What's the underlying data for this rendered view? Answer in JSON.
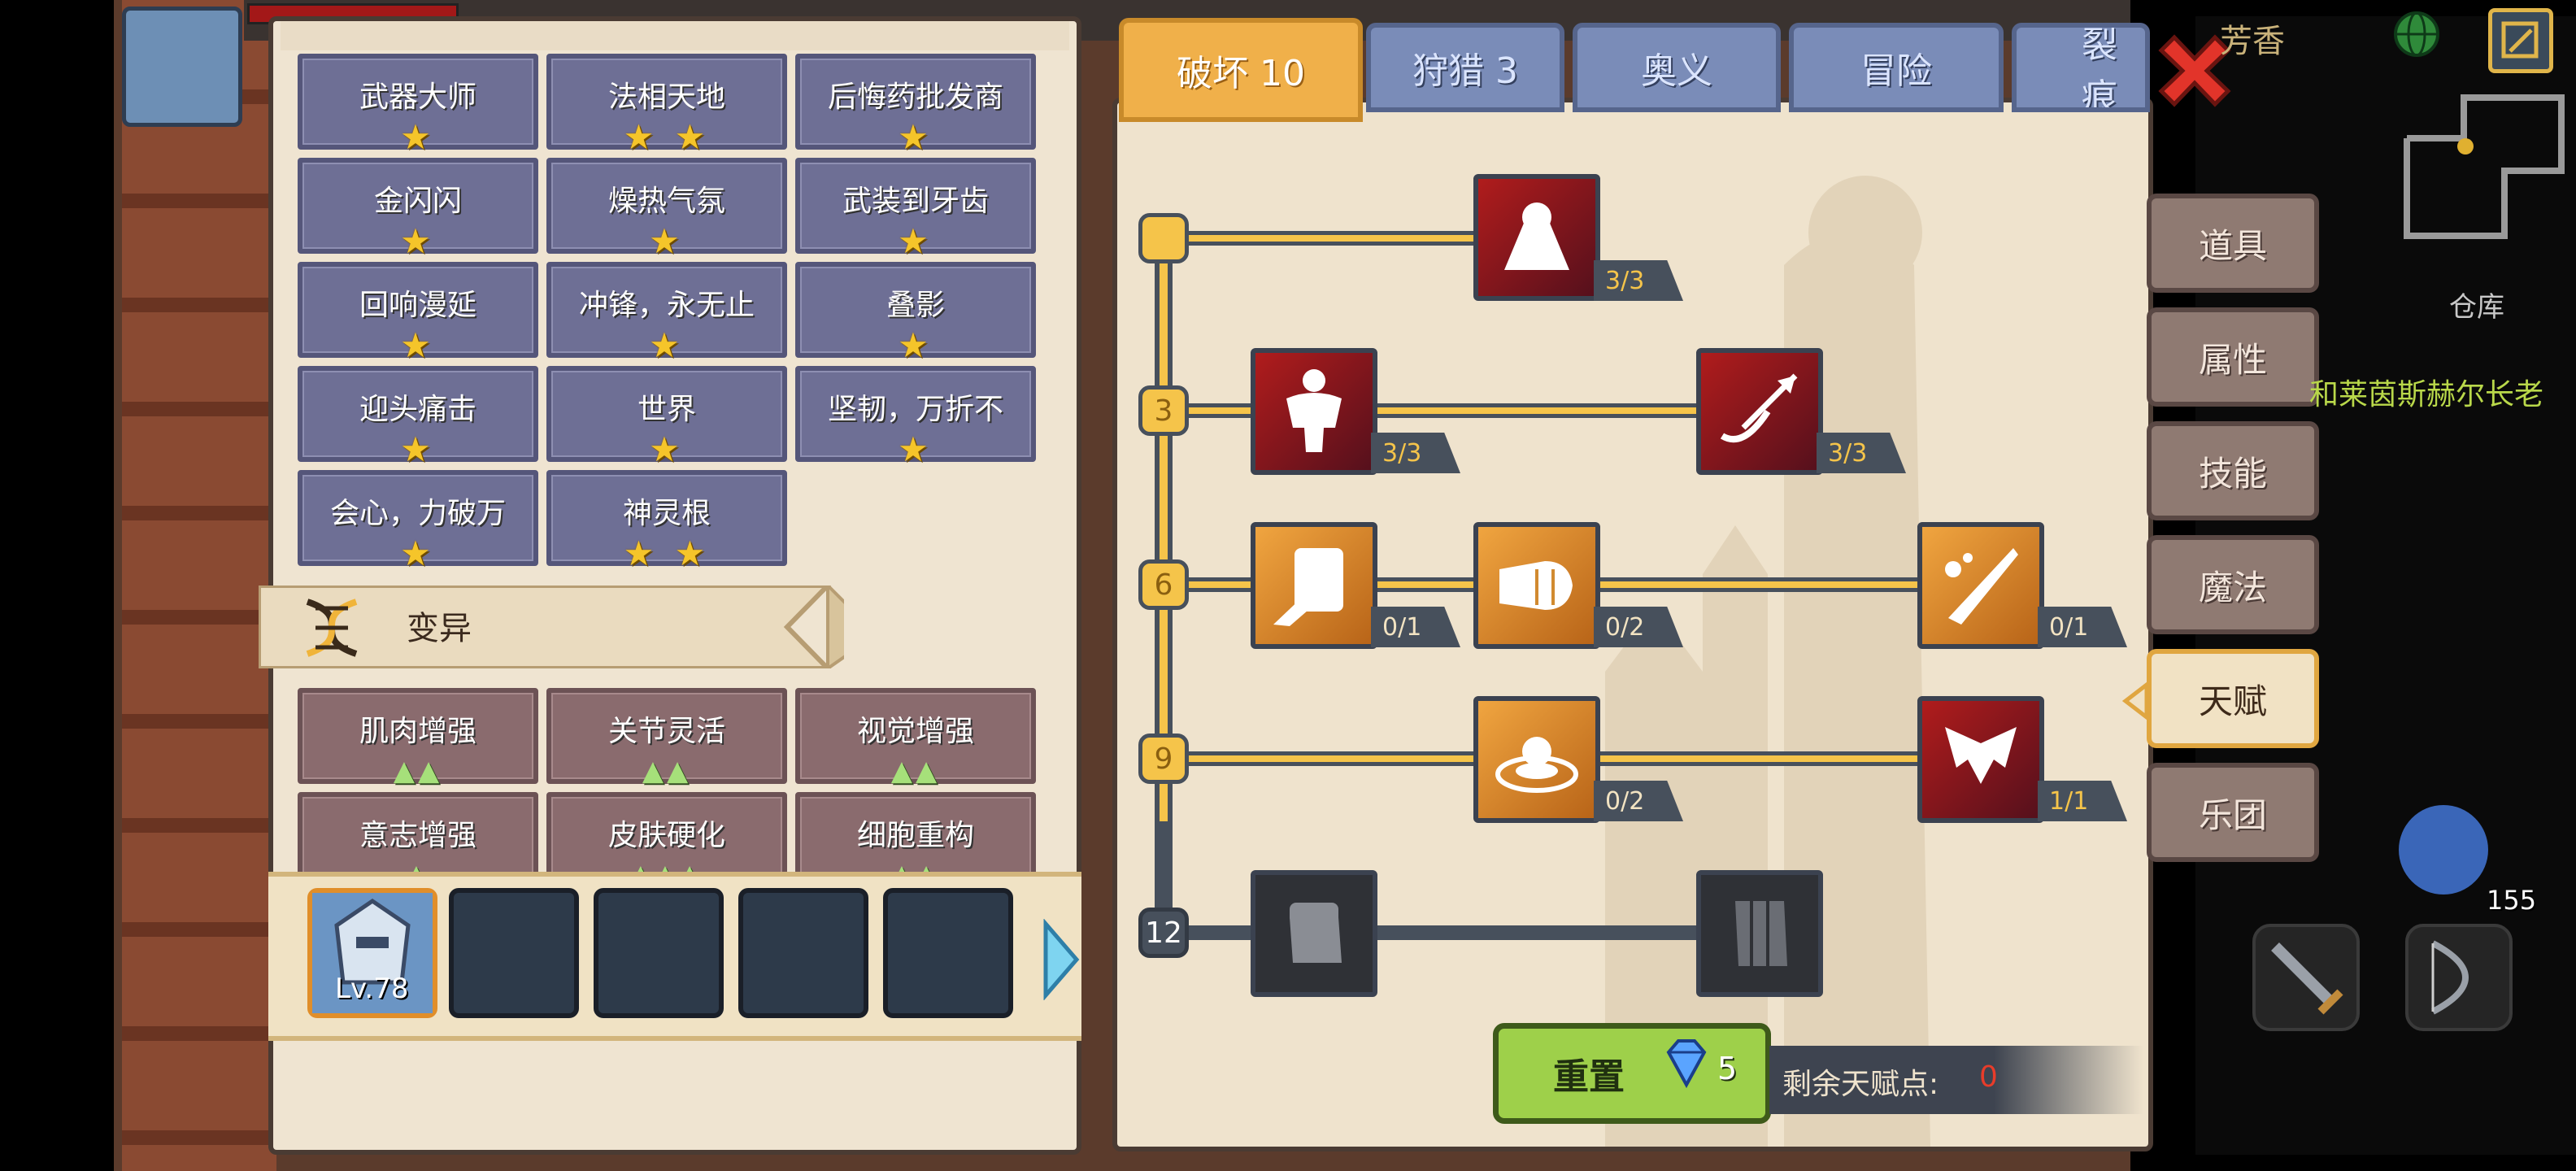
{
  "left_panel": {
    "traits": [
      {
        "name": "武器大师",
        "stars": "★",
        "color": "blue"
      },
      {
        "name": "法相天地",
        "stars": "★ ★",
        "color": "blue"
      },
      {
        "name": "后悔药批发商",
        "stars": "★",
        "color": "blue"
      },
      {
        "name": "金闪闪",
        "stars": "★",
        "color": "blue"
      },
      {
        "name": "燥热气氛",
        "stars": "★",
        "color": "blue"
      },
      {
        "name": "武装到牙齿",
        "stars": "★",
        "color": "blue"
      },
      {
        "name": "回响漫延",
        "stars": "★",
        "color": "blue"
      },
      {
        "name": "冲锋，永无止",
        "stars": "★",
        "color": "blue"
      },
      {
        "name": "叠影",
        "stars": "★",
        "color": "blue"
      },
      {
        "name": "迎头痛击",
        "stars": "★",
        "color": "blue"
      },
      {
        "name": "世界",
        "stars": "★",
        "color": "blue"
      },
      {
        "name": "坚韧，万折不",
        "stars": "★",
        "color": "blue"
      },
      {
        "name": "会心，力破万",
        "stars": "★",
        "color": "blue"
      },
      {
        "name": "神灵根",
        "stars": "★ ★",
        "color": "blue"
      }
    ],
    "mutation_title": "变异",
    "mutations": [
      {
        "name": "肌肉增强",
        "marks": "▲▲"
      },
      {
        "name": "关节灵活",
        "marks": "▲▲"
      },
      {
        "name": "视觉增强",
        "marks": "▲▲"
      },
      {
        "name": "意志增强",
        "marks": "▲"
      },
      {
        "name": "皮肤硬化",
        "marks": "▲▲▲"
      },
      {
        "name": "细胞重构",
        "marks": "▲▲"
      }
    ],
    "party": {
      "hero_level": "Lv.78"
    }
  },
  "tabs": [
    {
      "label": "破坏 10",
      "active": true
    },
    {
      "label": "狩猎 3",
      "active": false
    },
    {
      "label": "奥义",
      "active": false
    },
    {
      "label": "冒险",
      "active": false
    },
    {
      "label": "裂痕",
      "active": false
    }
  ],
  "talent_tree": {
    "levels": [
      "",
      "3",
      "6",
      "9",
      "12"
    ],
    "nodes": [
      {
        "id": "arm-wrestle",
        "count": "3/3"
      },
      {
        "id": "muscle-body",
        "count": "3/3"
      },
      {
        "id": "arrow-strike",
        "count": "3/3"
      },
      {
        "id": "card-dash",
        "count": "0/1"
      },
      {
        "id": "punch",
        "count": "0/2"
      },
      {
        "id": "slash-splash",
        "count": "0/1"
      },
      {
        "id": "ground-ripple",
        "count": "0/2"
      },
      {
        "id": "demon-wings",
        "count": "1/1"
      },
      {
        "id": "fist-locked",
        "count": ""
      },
      {
        "id": "fist-locked-2",
        "count": ""
      }
    ],
    "reset_label": "重置",
    "reset_cost": "5",
    "remaining_label": "剩余天赋点:",
    "remaining_value": "0"
  },
  "side_menu": [
    {
      "label": "道具",
      "active": false
    },
    {
      "label": "属性",
      "active": false
    },
    {
      "label": "技能",
      "active": false
    },
    {
      "label": "魔法",
      "active": false
    },
    {
      "label": "天赋",
      "active": true
    },
    {
      "label": "乐团",
      "active": false
    }
  ],
  "top_right": {
    "name": "芳香",
    "map_label": "仓库",
    "npc": "和莱茵斯赫尔长老",
    "item_count": "155"
  },
  "colors": {
    "gold": "#f5c44a",
    "accent_tab": "#f0b04a",
    "inactive_tab": "#7a8cb8",
    "reset_green": "#9ed04a",
    "remaining_red": "#e83c2a"
  }
}
